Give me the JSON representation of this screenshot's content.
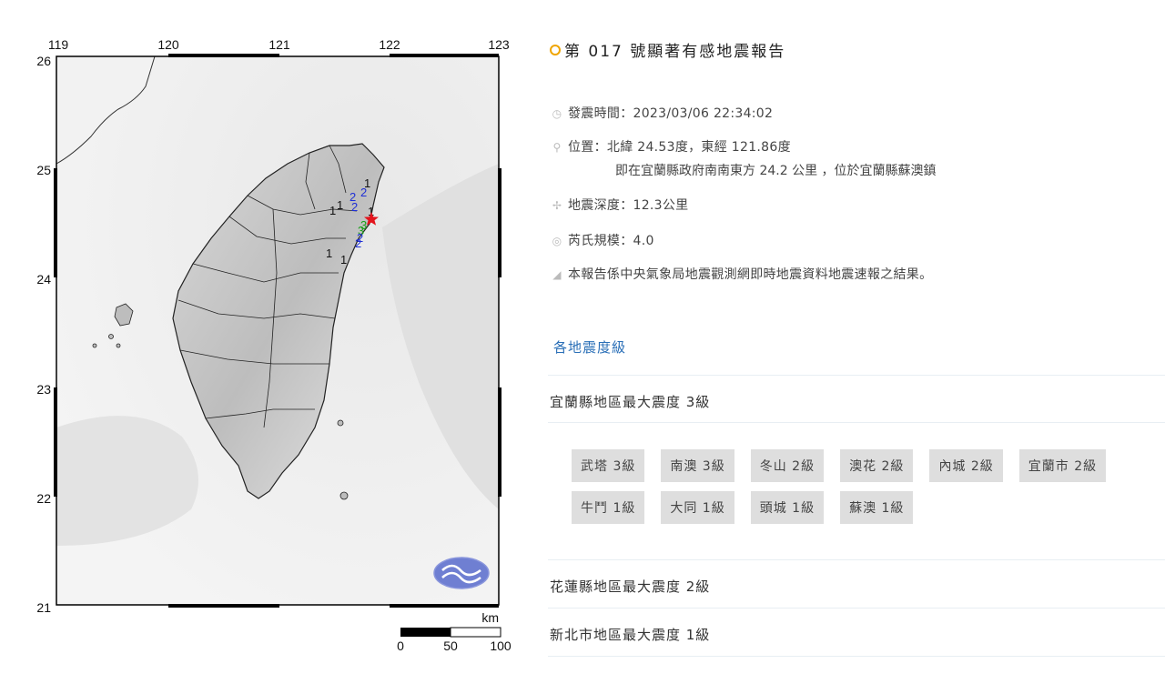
{
  "map": {
    "lon_ticks": [
      "119",
      "120",
      "121",
      "122",
      "123"
    ],
    "lat_ticks": [
      "26",
      "25",
      "24",
      "23",
      "22",
      "21"
    ],
    "scale": {
      "unit": "km",
      "labels": [
        "0",
        "50",
        "100"
      ]
    },
    "intensity_marks": [
      {
        "value": "2",
        "color": "#1e2fd6"
      },
      {
        "value": "2",
        "color": "#1e2fd6"
      },
      {
        "value": "2",
        "color": "#1e2fd6"
      },
      {
        "value": "1",
        "color": "#111111"
      },
      {
        "value": "1",
        "color": "#111111"
      },
      {
        "value": "1",
        "color": "#111111"
      },
      {
        "value": "1",
        "color": "#111111"
      },
      {
        "value": "3",
        "color": "#1aa01a"
      },
      {
        "value": "3",
        "color": "#1aa01a"
      },
      {
        "value": "2",
        "color": "#1e2fd6"
      },
      {
        "value": "2",
        "color": "#1e2fd6"
      },
      {
        "value": "1",
        "color": "#111111"
      },
      {
        "value": "1",
        "color": "#111111"
      }
    ],
    "epicenter_color": "#e3141c"
  },
  "report": {
    "title": "第 017 號顯著有感地震報告",
    "time_label": "發震時間：2023/03/06 22:34:02",
    "location_label": "位置：北緯 24.53度，東經 121.86度",
    "location_sub": "即在宜蘭縣政府南南東方 24.2 公里 ，位於宜蘭縣蘇澳鎮",
    "depth_label": "地震深度：12.3公里",
    "magnitude_label": "芮氏規模：4.0",
    "note": "本報告係中央氣象局地震觀測網即時地震資料地震速報之結果。",
    "section_title": "各地震度級",
    "regions": [
      "宜蘭縣地區最大震度 3級",
      "花蓮縣地區最大震度 2級",
      "新北市地區最大震度 1級"
    ],
    "stations": [
      "武塔 3級",
      "南澳 3級",
      "冬山 2級",
      "澳花 2級",
      "內城 2級",
      "宜蘭市 2級",
      "牛鬥 1級",
      "大同 1級",
      "頭城 1級",
      "蘇澳 1級"
    ]
  }
}
